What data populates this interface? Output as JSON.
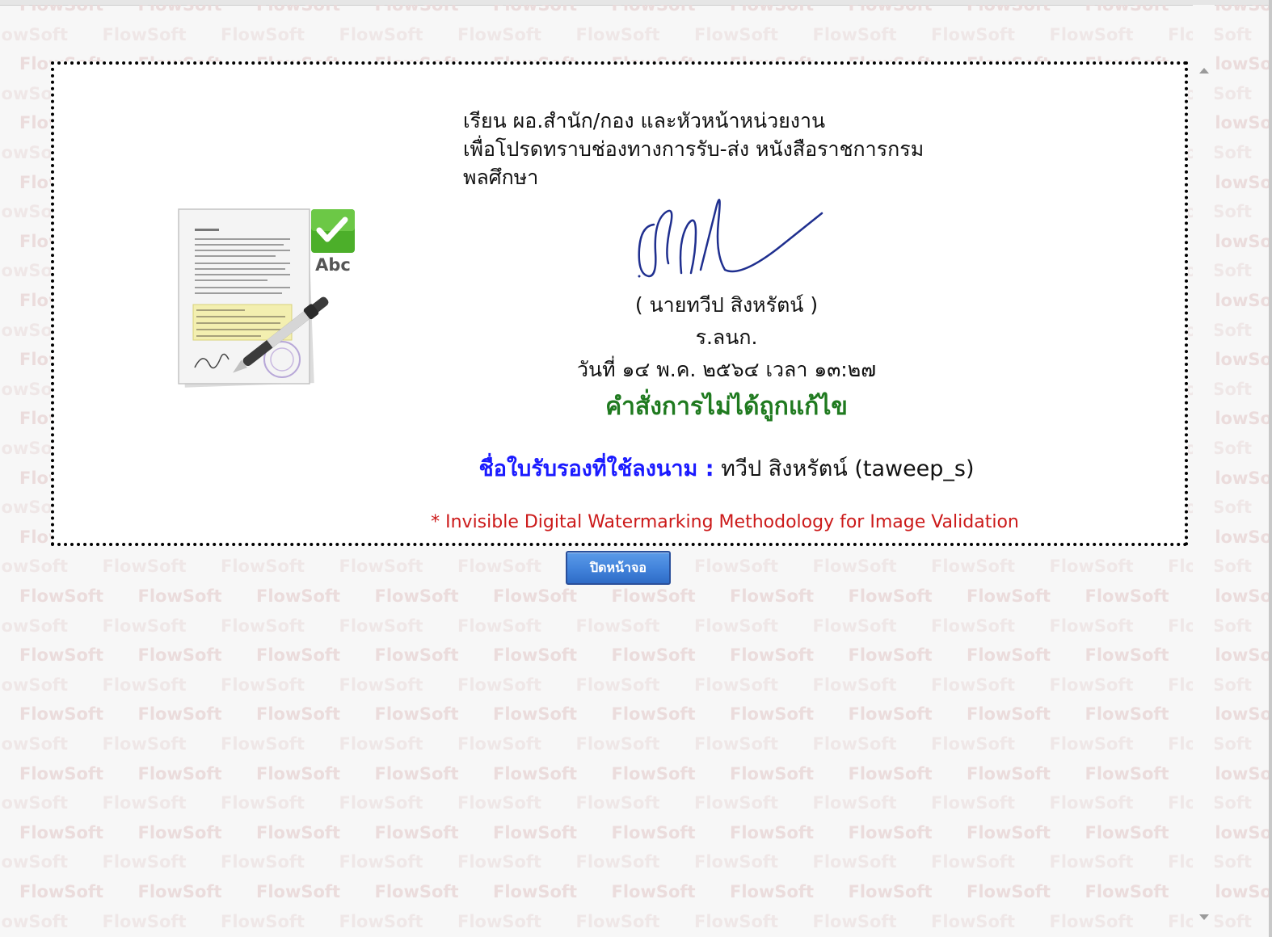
{
  "background": {
    "watermark_text": "FlowSoft",
    "watermark_color": "#eadada"
  },
  "letter": {
    "lines": [
      "เรียน ผอ.สำนัก/กอง และหัวหน้าหน่วยงาน",
      "เพื่อโปรดทราบช่องทางการรับ-ส่ง หนังสือราชการกรม",
      "พลศึกษา"
    ]
  },
  "signer": {
    "name": "( นายทวีป สิงหรัตน์ )",
    "position": "ร.ลนก.",
    "date_time": "วันที่ ๑๔ พ.ค. ๒๕๖๔ เวลา ๑๓:๒๗"
  },
  "status": {
    "text": "คำสั่งการไม่ได้ถูกแก้ไข",
    "color": "#1f7a1f"
  },
  "certificate": {
    "label": "ชื่อใบรับรองที่ใช้ลงนาม :",
    "value": "ทวีป สิงหรัตน์ (taweep_s)",
    "label_color": "#1a1aff"
  },
  "footnote": {
    "text": "* Invisible Digital Watermarking Methodology for Image Validation",
    "color": "#cc1a1a"
  },
  "icon": {
    "name": "signed-document-icon",
    "badge_text": "Abc",
    "check_color": "#4caf2a"
  },
  "buttons": {
    "close_label": "ปิดหน้าจอ"
  }
}
